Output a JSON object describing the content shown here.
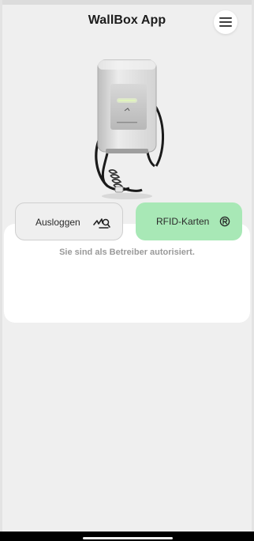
{
  "header": {
    "title": "WallBox App",
    "menu_icon": "hamburger-menu-icon"
  },
  "hero": {
    "image": "wallbox-charger-illustration"
  },
  "actions": {
    "logout_label": "Ausloggen",
    "logout_icon": "signature-logout-icon",
    "rfid_label": "RFID-Karten",
    "rfid_icon": "rfid-card-icon"
  },
  "status": {
    "message": "Sie sind als Betreiber autorisiert."
  },
  "colors": {
    "background": "#efefef",
    "card": "#ffffff",
    "rfid_button": "#a8e8b6",
    "logout_button": "#efefef",
    "message_text": "#9a9a9a"
  }
}
